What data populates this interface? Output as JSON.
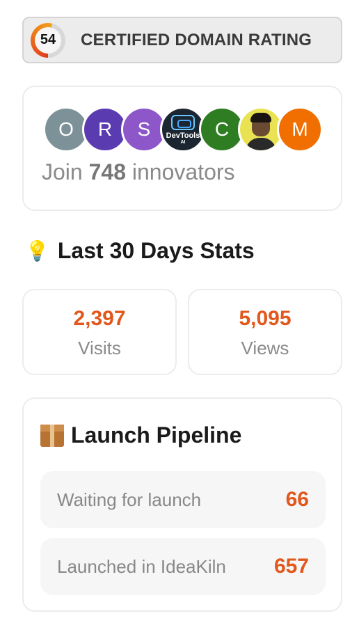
{
  "rating": {
    "score": "54",
    "score_fraction": 0.54,
    "label": "CERTIFIED DOMAIN RATING"
  },
  "join": {
    "avatars": [
      {
        "kind": "letter",
        "text": "O",
        "color": "#7d9199"
      },
      {
        "kind": "letter",
        "text": "R",
        "color": "#5b3bb0"
      },
      {
        "kind": "letter",
        "text": "S",
        "color": "#8e57c9"
      },
      {
        "kind": "logo",
        "text": "DevTools",
        "sub": "AI"
      },
      {
        "kind": "letter",
        "text": "C",
        "color": "#2f7d22"
      },
      {
        "kind": "photo"
      },
      {
        "kind": "letter",
        "text": "M",
        "color": "#f06f00"
      }
    ],
    "prefix": "Join",
    "count": "748",
    "suffix": "innovators"
  },
  "stats": {
    "title": "Last 30 Days Stats",
    "visits": {
      "value": "2,397",
      "label": "Visits"
    },
    "views": {
      "value": "5,095",
      "label": "Views"
    }
  },
  "pipeline": {
    "title": "Launch Pipeline",
    "rows": [
      {
        "label": "Waiting for launch",
        "value": "66"
      },
      {
        "label": "Launched in IdeaKiln",
        "value": "657"
      }
    ]
  },
  "colors": {
    "accent": "#e2571b",
    "ring_low": "#e23b1e",
    "ring_high": "#f2a21a"
  }
}
